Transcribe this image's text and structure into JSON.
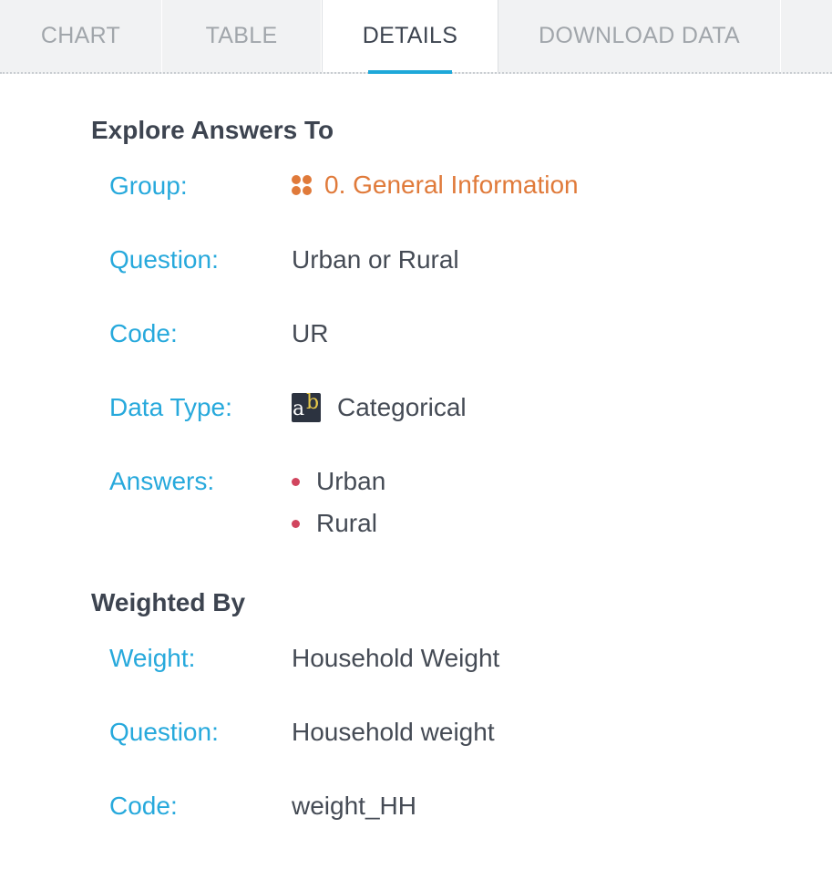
{
  "tabs": [
    {
      "label": "CHART"
    },
    {
      "label": "TABLE"
    },
    {
      "label": "DETAILS"
    },
    {
      "label": "DOWNLOAD DATA"
    }
  ],
  "explore": {
    "title": "Explore Answers To",
    "group_label": "Group:",
    "group_value": "0. General Information",
    "question_label": "Question:",
    "question_value": "Urban or Rural",
    "code_label": "Code:",
    "code_value": "UR",
    "datatype_label": "Data Type:",
    "datatype_value": "Categorical",
    "answers_label": "Answers:",
    "answers": [
      "Urban",
      "Rural"
    ]
  },
  "weighted": {
    "title": "Weighted By",
    "weight_label": "Weight:",
    "weight_value": "Household Weight",
    "question_label": "Question:",
    "question_value": "Household weight",
    "code_label": "Code:",
    "code_value": "weight_HH"
  },
  "colors": {
    "accent": "#27a9dc",
    "group": "#e07a3a",
    "bullet": "#d1455e",
    "tab_underline": "#1ea8d9"
  },
  "icons": {
    "group": "grid-dots-icon",
    "datatype": "ab-text-icon"
  }
}
